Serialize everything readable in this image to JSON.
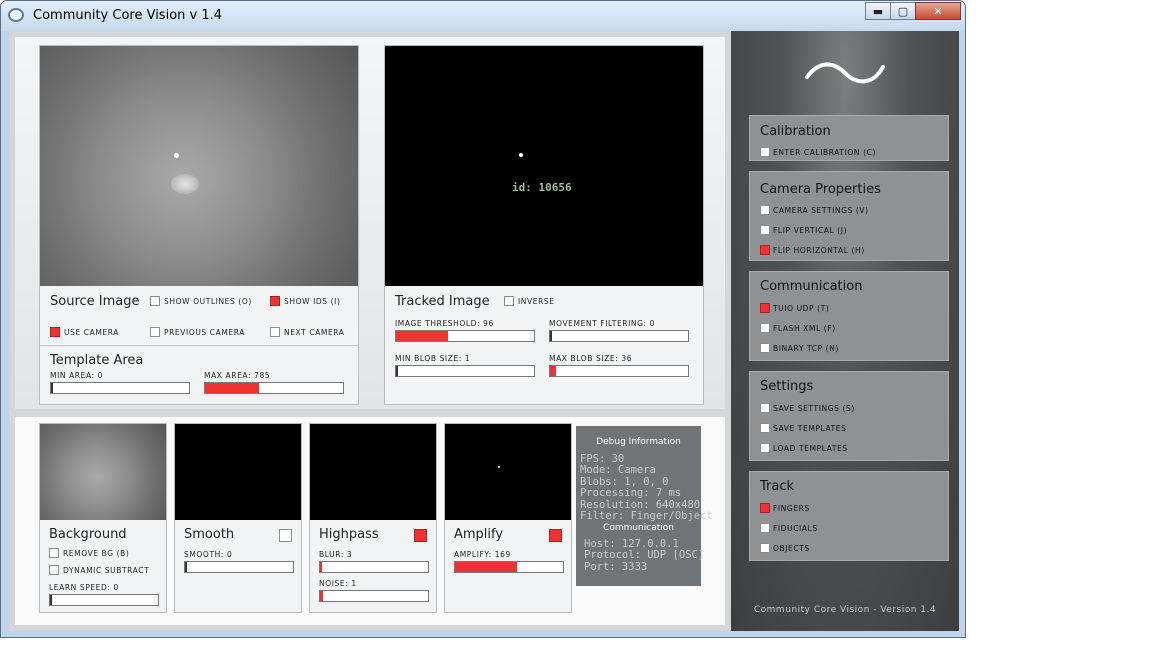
{
  "window": {
    "title": "Community Core Vision v 1.4",
    "minimize": "▬",
    "maximize": "▢",
    "close": "✕"
  },
  "source": {
    "title": "Source Image",
    "show_outlines": {
      "label": "show outlines (o)",
      "checked": false
    },
    "show_ids": {
      "label": "show ids (i)",
      "checked": true
    },
    "use_camera": {
      "label": "use camera",
      "checked": true
    },
    "previous_camera": {
      "label": "previous camera",
      "checked": false
    },
    "next_camera": {
      "label": "next camera",
      "checked": false
    }
  },
  "template": {
    "title": "Template Area",
    "min_area": {
      "label": "min area: 0",
      "value": 0
    },
    "max_area": {
      "label": "max area: 785",
      "value": 0.39
    }
  },
  "tracked": {
    "title": "Tracked Image",
    "blob_label": "id: 10656",
    "inverse": {
      "label": "inverse",
      "checked": false
    },
    "image_threshold": {
      "label": "image threshold: 96",
      "value": 0.38
    },
    "movement_filtering": {
      "label": "movement filtering: 0",
      "value": 0
    },
    "min_blob_size": {
      "label": "min blob size: 1",
      "value": 0.01
    },
    "max_blob_size": {
      "label": "max blob size: 36",
      "value": 0.04
    }
  },
  "filters": {
    "background": {
      "title": "Background",
      "remove_bg": {
        "label": "remove bg (b)",
        "checked": false
      },
      "dynamic_subtract": {
        "label": "dynamic subtract",
        "checked": false
      },
      "learn_speed": {
        "label": "learn speed: 0",
        "value": 0
      }
    },
    "smooth": {
      "title": "Smooth",
      "checked": false,
      "smooth": {
        "label": "smooth: 0",
        "value": 0
      }
    },
    "highpass": {
      "title": "Highpass",
      "checked": true,
      "blur": {
        "label": "blur: 3",
        "value": 0.02
      },
      "noise": {
        "label": "noise: 1",
        "value": 0.03
      }
    },
    "amplify": {
      "title": "Amplify",
      "checked": true,
      "amplify": {
        "label": "amplify: 169",
        "value": 0.57
      }
    }
  },
  "debug": {
    "title": "Debug Information",
    "fps": "FPS: 30",
    "mode": "Mode: Camera",
    "blobs": "Blobs: 1, 0, 0",
    "processing": "Processing: 7 ms",
    "resolution": "Resolution: 640x480",
    "filter": "Filter: Finger/Object",
    "comm_title": "Communication",
    "host": "Host: 127.0.0.1",
    "protocol": "Protocol: UDP [OSC]",
    "port": "Port: 3333"
  },
  "sidebar": {
    "calibration": {
      "title": "Calibration",
      "enter": {
        "label": "enter calibration (c)",
        "checked": false
      }
    },
    "camera": {
      "title": "Camera Properties",
      "settings": {
        "label": "camera settings (v)",
        "checked": false
      },
      "flip_vertical": {
        "label": "flip vertical (j)",
        "checked": false
      },
      "flip_horizontal": {
        "label": "flip horizontal (h)",
        "checked": true
      }
    },
    "communication": {
      "title": "Communication",
      "tuio": {
        "label": "tuio udp (t)",
        "checked": true
      },
      "flash": {
        "label": "flash xml (f)",
        "checked": false
      },
      "tcp": {
        "label": "binary tcp (n)",
        "checked": false
      }
    },
    "settings": {
      "title": "Settings",
      "save": {
        "label": "save settings (s)",
        "checked": false
      },
      "save_templates": {
        "label": "save templates",
        "checked": false
      },
      "load_templates": {
        "label": "load templates",
        "checked": false
      }
    },
    "track": {
      "title": "Track",
      "fingers": {
        "label": "fingers",
        "checked": true
      },
      "fiducials": {
        "label": "fiducials",
        "checked": false
      },
      "objects": {
        "label": "objects",
        "checked": false
      }
    },
    "footer": "Community Core Vision - Version 1.4"
  },
  "colors": {
    "accent": "#ee3333",
    "sidebar_bg": "#4a4c4e"
  }
}
